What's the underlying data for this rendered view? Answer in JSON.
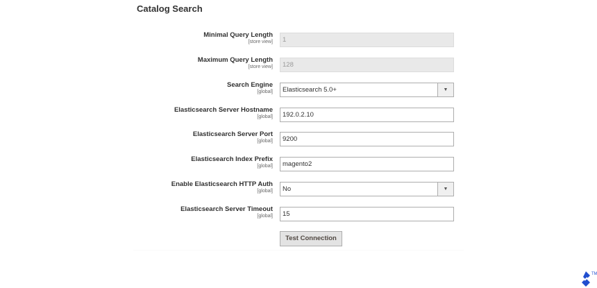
{
  "section": {
    "title": "Catalog Search"
  },
  "fields": [
    {
      "label": "Minimal Query Length",
      "scope": "[store view]",
      "value": "1",
      "type": "text",
      "disabled": true
    },
    {
      "label": "Maximum Query Length",
      "scope": "[store view]",
      "value": "128",
      "type": "text",
      "disabled": true
    },
    {
      "label": "Search Engine",
      "scope": "[global]",
      "value": "Elasticsearch 5.0+",
      "type": "select"
    },
    {
      "label": "Elasticsearch Server Hostname",
      "scope": "[global]",
      "value": "192.0.2.10",
      "type": "text"
    },
    {
      "label": "Elasticsearch Server Port",
      "scope": "[global]",
      "value": "9200",
      "type": "text"
    },
    {
      "label": "Elasticsearch Index Prefix",
      "scope": "[global]",
      "value": "magento2",
      "type": "text"
    },
    {
      "label": "Enable Elasticsearch HTTP Auth",
      "scope": "[global]",
      "value": "No",
      "type": "select"
    },
    {
      "label": "Elasticsearch Server Timeout",
      "scope": "[global]",
      "value": "15",
      "type": "text"
    }
  ],
  "actions": {
    "test_connection": "Test Connection"
  },
  "icons": {
    "dropdown": "chevron-down-icon",
    "logo": "toptal-logo-icon"
  },
  "colors": {
    "logo": "#204ecf"
  }
}
